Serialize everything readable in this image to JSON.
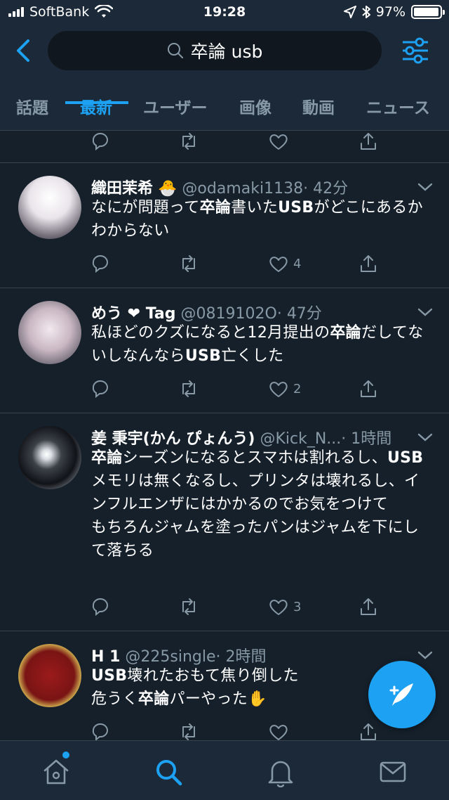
{
  "status_bar": {
    "carrier": "SoftBank",
    "time": "19:28",
    "battery": "97%"
  },
  "search": {
    "query": "卒論 usb"
  },
  "tabs": [
    {
      "label": "話題"
    },
    {
      "label": "最新"
    },
    {
      "label": "ユーザー"
    },
    {
      "label": "画像"
    },
    {
      "label": "動画"
    },
    {
      "label": "ニュース"
    }
  ],
  "active_tab": "最新",
  "tweets": [
    {
      "name": "織田茉希",
      "emoji": "🐣",
      "handle": "@odamaki1138",
      "time": "· 42分",
      "body_parts": [
        "なにが問題って",
        "卒論",
        "書いた",
        "USB",
        "がどこにあるかわからない"
      ],
      "likes": "4"
    },
    {
      "name": "めう ❤ Tag",
      "handle": "@0819102O",
      "time": "· 47分",
      "body_parts": [
        "私ほどのクズになると12月提出の",
        "卒論",
        "だしてないしなんなら",
        "USB",
        "亡くした"
      ],
      "likes": "2"
    },
    {
      "name": "姜 秉宇(かん ぴょんう)",
      "handle": "@Kick_N...",
      "time": "· 1時間",
      "body_parts": [
        "卒論",
        "シーズンになるとスマホは割れるし、",
        "USB",
        "メモリは無くなるし、プリンタは壊れるし、インフルエンザにはかかるのでお気をつけて\nもちろんジャムを塗ったパンはジャムを下にして落ちる"
      ],
      "likes": "3"
    },
    {
      "name": "H 1",
      "handle": "@225single",
      "time": "· 2時間",
      "body_parts": [
        "USB",
        "壊れたおもて焦り倒した\n危うく",
        "卒論",
        "パーやった",
        "✋"
      ],
      "likes": ""
    }
  ],
  "colors": {
    "accent": "#1da1f2",
    "background": "#15202b",
    "header": "#1c2938",
    "secondary": "#8899a6"
  }
}
